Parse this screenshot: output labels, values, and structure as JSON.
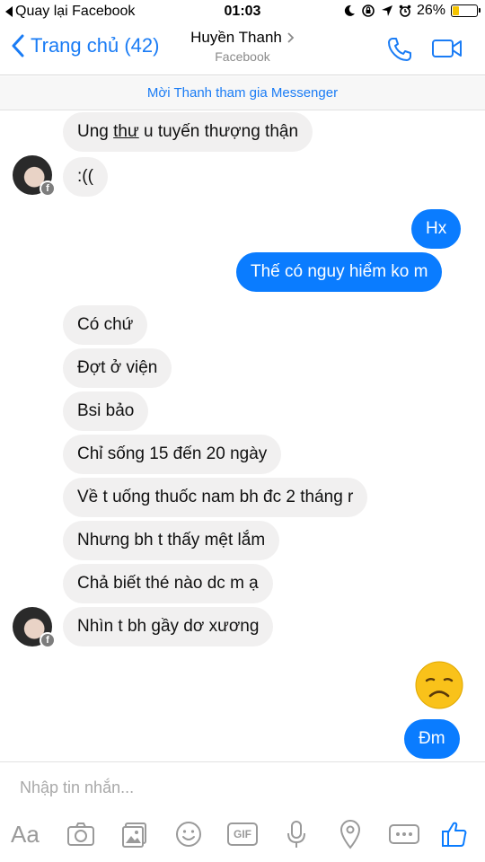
{
  "status_bar": {
    "back_app_label": "Quay lại Facebook",
    "time": "01:03",
    "battery": "26%",
    "battery_level": 0.26
  },
  "header": {
    "back_label": "Trang chủ (42)",
    "contact_name": "Huyền Thanh",
    "contact_subtitle": "Facebook",
    "phone_icon": "phone-icon",
    "video_icon": "video-camera-icon"
  },
  "invite_banner": "Mời Thanh tham gia Messenger",
  "messages": {
    "m1_pre": "Ung ",
    "m1_under": "thư",
    "m1_post": " u tuyến thượng thận",
    "m2": ":((",
    "m3": "Hx",
    "m4": "Thế có nguy hiểm ko m",
    "m5": "Có chứ",
    "m6": "Đợt ở viện",
    "m7": "Bsi bảo",
    "m8": "Chỉ sống 15 đến 20 ngày",
    "m9": "Về t uống thuốc nam bh đc 2 tháng r",
    "m10": "Nhưng bh t thấy mệt lắm",
    "m11": "Chả biết thé nào dc m ạ",
    "m12": "Nhìn t bh gầy dơ xương",
    "m13_emoji": "sad-face-emoji",
    "m14": "Đm"
  },
  "composer": {
    "placeholder": "Nhập tin nhắn...",
    "aa_label": "Aa",
    "gif_label": "GIF",
    "tools": [
      "text-format-icon",
      "camera-icon",
      "gallery-icon",
      "emoji-icon",
      "gif-icon",
      "microphone-icon",
      "location-icon",
      "more-icon",
      "like-icon"
    ]
  },
  "colors": {
    "accent": "#0a7cff",
    "incoming_bubble": "#f1f0f0",
    "outgoing_bubble": "#0a7cff"
  }
}
